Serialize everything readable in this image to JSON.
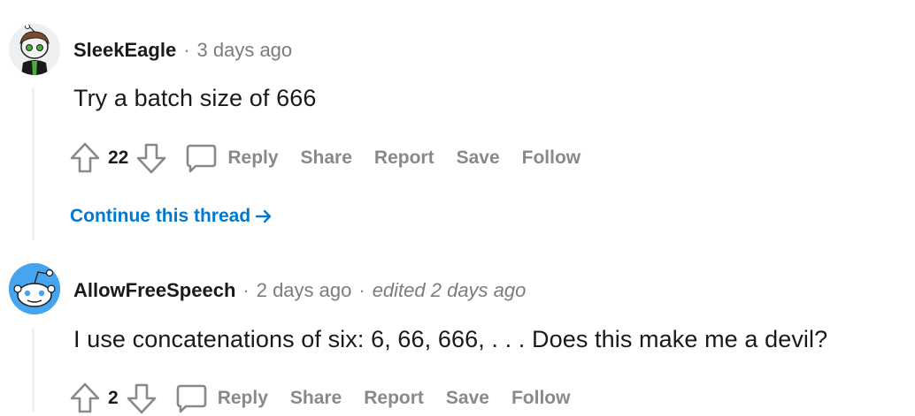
{
  "comments": [
    {
      "author": "SleekEagle",
      "time": "3 days ago",
      "body": "Try a batch size of 666",
      "score": "22",
      "actions": {
        "reply": "Reply",
        "share": "Share",
        "report": "Report",
        "save": "Save",
        "follow": "Follow"
      },
      "continue_label": "Continue this thread"
    },
    {
      "author": "AllowFreeSpeech",
      "time": "2 days ago",
      "edited": "edited 2 days ago",
      "body": "I use concatenations of six: 6, 66, 666, . . . Does this make me a devil?",
      "score": "2",
      "actions": {
        "reply": "Reply",
        "share": "Share",
        "report": "Report",
        "save": "Save",
        "follow": "Follow"
      }
    }
  ],
  "colors": {
    "link": "#0079d3",
    "muted": "#878a8c",
    "avatar2_bg": "#46a5ee"
  },
  "icons": [
    "upvote-icon",
    "downvote-icon",
    "comment-bubble-icon",
    "arrow-right-icon",
    "avatar-icon"
  ]
}
